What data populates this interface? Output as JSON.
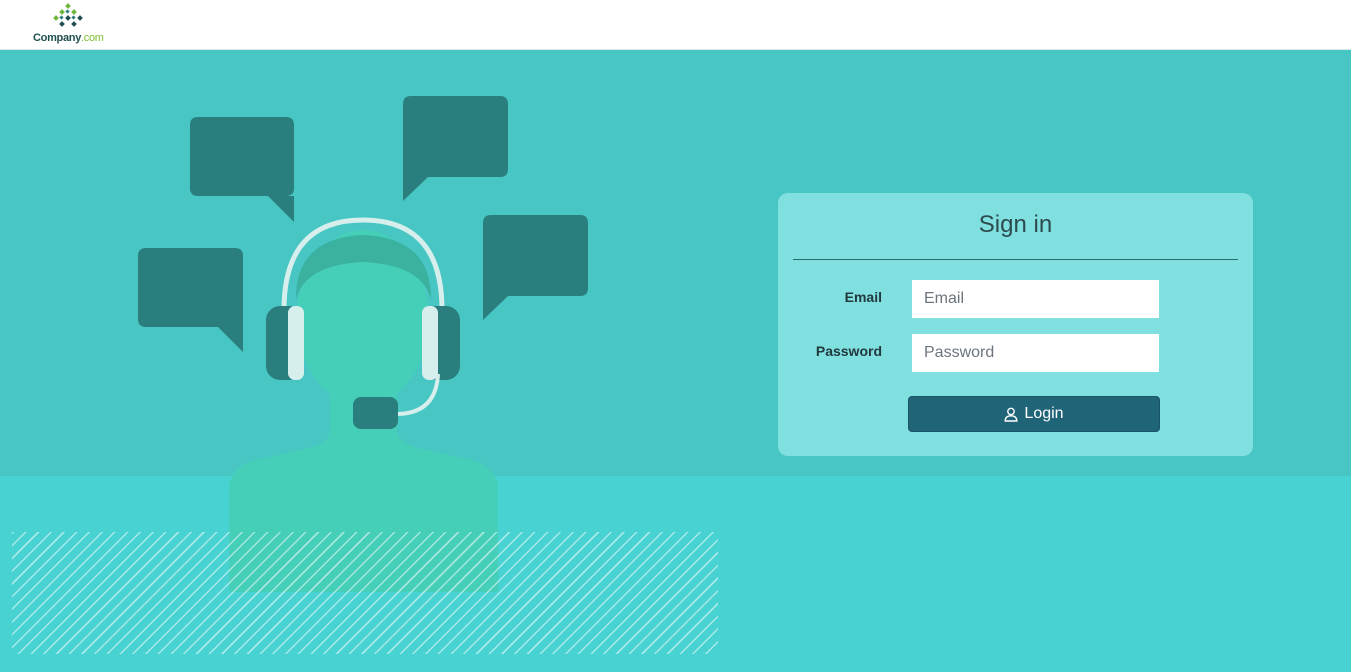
{
  "header": {
    "logo": {
      "name": "Company",
      "domain": ".com"
    }
  },
  "login": {
    "title": "Sign in",
    "email": {
      "label": "Email",
      "placeholder": "Email",
      "value": ""
    },
    "password": {
      "label": "Password",
      "placeholder": "Password",
      "value": ""
    },
    "button": {
      "label": "Login",
      "icon": "user-icon"
    }
  },
  "colors": {
    "hero": "#47c6c4",
    "lower": "#48d2d1",
    "card": "#80dfdf",
    "button": "#206478",
    "bubble": "#2a7f7e",
    "figure": "#45cfb8"
  }
}
